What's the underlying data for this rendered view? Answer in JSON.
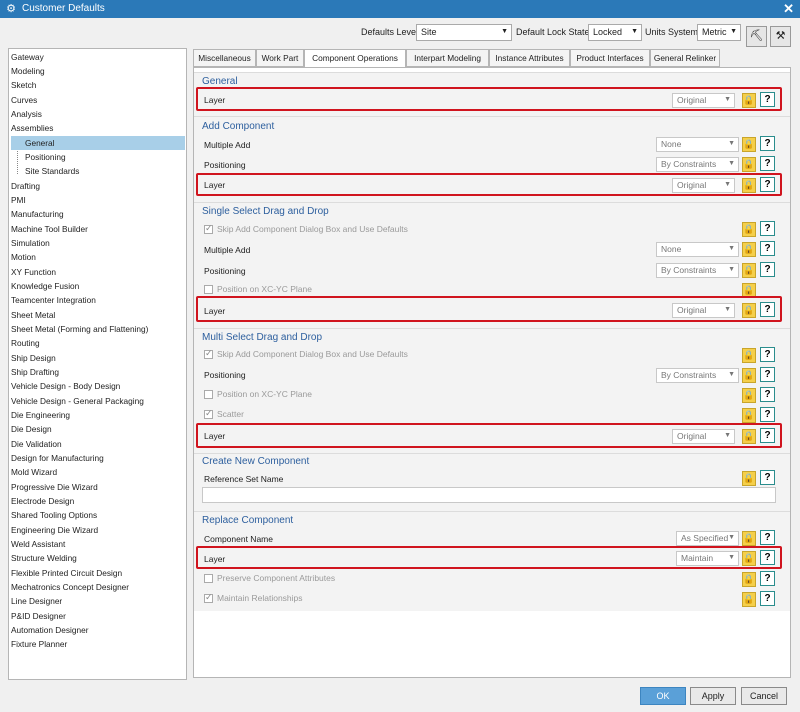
{
  "window": {
    "title": "Customer Defaults",
    "close": "✕",
    "icon": "gear-icon"
  },
  "toolbar": {
    "defaults_level_label": "Defaults Level",
    "defaults_level_value": "Site",
    "lock_state_label": "Default Lock State",
    "lock_state_value": "Locked",
    "units_label": "Units System",
    "units_value": "Metric",
    "icons": [
      "find-default-icon",
      "manage-current-settings-icon"
    ]
  },
  "tree": {
    "items": [
      "Gateway",
      "Modeling",
      "Sketch",
      "Curves",
      "Analysis",
      "Assemblies"
    ],
    "children": [
      "General",
      "Positioning",
      "Site Standards"
    ],
    "items2": [
      "Drafting",
      "PMI",
      "Manufacturing",
      "Machine Tool Builder",
      "Simulation",
      "Motion",
      "XY Function",
      "Knowledge Fusion",
      "Teamcenter Integration",
      "Sheet Metal",
      "Sheet Metal (Forming and Flattening)",
      "Routing",
      "Ship Design",
      "Ship Drafting",
      "Vehicle Design - Body Design",
      "Vehicle Design - General Packaging",
      "Die Engineering",
      "Die Design",
      "Die Validation",
      "Design for Manufacturing",
      "Mold Wizard",
      "Progressive Die Wizard",
      "Electrode Design",
      "Shared Tooling Options",
      "Engineering Die Wizard",
      "Weld Assistant",
      "Structure Welding",
      "Flexible Printed Circuit Design",
      "Mechatronics Concept Designer",
      "Line Designer",
      "P&ID Designer",
      "Automation Designer",
      "Fixture Planner"
    ]
  },
  "tabs": [
    "Miscellaneous",
    "Work Part",
    "Component Operations",
    "Interpart Modeling",
    "Instance Attributes",
    "Product Interfaces",
    "General Relinker"
  ],
  "general": {
    "title": "General",
    "layer_label": "Layer",
    "layer_value": "Original"
  },
  "add_component": {
    "title": "Add Component",
    "multiple_add_label": "Multiple Add",
    "multiple_add_value": "None",
    "positioning_label": "Positioning",
    "positioning_value": "By Constraints",
    "layer_label": "Layer",
    "layer_value": "Original"
  },
  "single_drag": {
    "title": "Single Select Drag and Drop",
    "skip_label": "Skip Add Component Dialog Box and Use Defaults",
    "multiple_add_label": "Multiple Add",
    "multiple_add_value": "None",
    "positioning_label": "Positioning",
    "positioning_value": "By Constraints",
    "position_plane_label": "Position on XC-YC Plane",
    "layer_label": "Layer",
    "layer_value": "Original"
  },
  "multi_drag": {
    "title": "Multi Select Drag and Drop",
    "skip_label": "Skip Add Component Dialog Box and Use Defaults",
    "positioning_label": "Positioning",
    "positioning_value": "By Constraints",
    "position_plane_label": "Position on XC-YC Plane",
    "scatter_label": "Scatter",
    "layer_label": "Layer",
    "layer_value": "Original"
  },
  "create_new": {
    "title": "Create New Component",
    "refset_label": "Reference Set Name",
    "refset_value": ""
  },
  "replace": {
    "title": "Replace Component",
    "name_label": "Component Name",
    "name_value": "As Specified",
    "layer_label": "Layer",
    "layer_value": "Maintain",
    "preserve_label": "Preserve Component Attributes",
    "maintain_label": "Maintain Relationships"
  },
  "glyphs": {
    "lock": "🔒",
    "help": "?",
    "arrow": "▼"
  },
  "buttons": {
    "ok": "OK",
    "apply": "Apply",
    "cancel": "Cancel"
  },
  "colors": {
    "title_bar": "#2b79b8",
    "highlight": "#d0141e",
    "section_title": "#2d5f9e",
    "lock": "#f5cf4a"
  }
}
